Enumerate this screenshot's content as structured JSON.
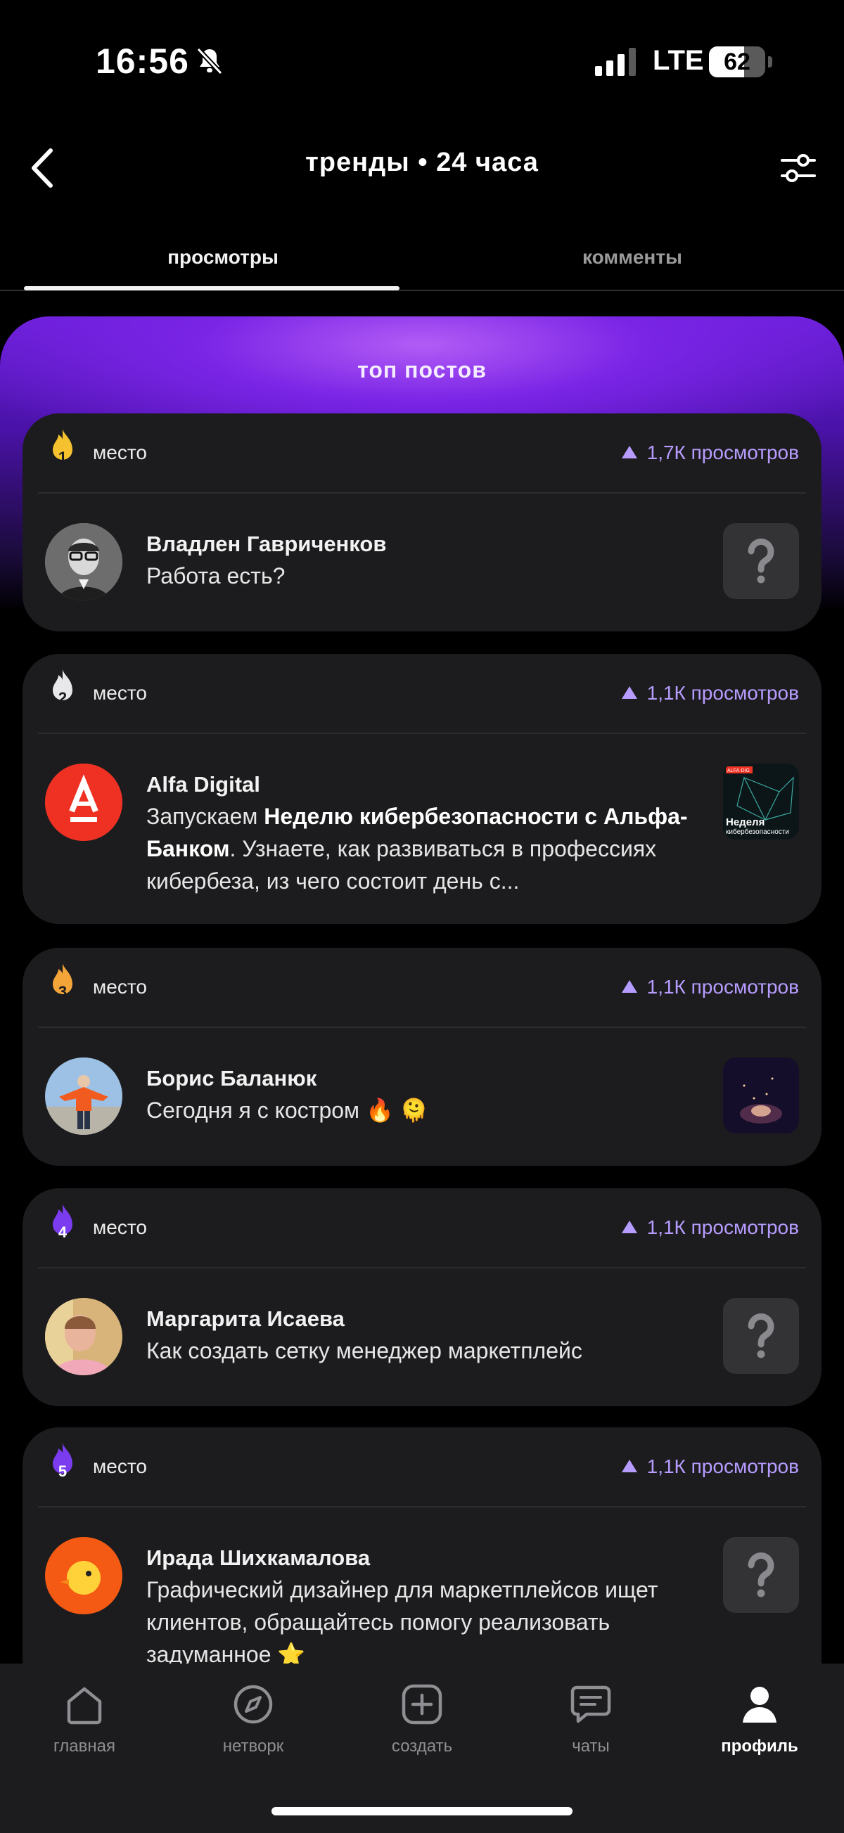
{
  "status_bar": {
    "time": "16:56",
    "network": "LTE",
    "battery": "62",
    "battery_level": 0.62
  },
  "header": {
    "title": "тренды • 24 часа"
  },
  "tabs": [
    {
      "label": "просмотры",
      "active": true
    },
    {
      "label": "комменты",
      "active": false
    }
  ],
  "section_title": "топ постов",
  "posts": [
    {
      "rank": "1",
      "rank_label": "место",
      "views": "1,7К просмотров",
      "author": "Владлен Гавриченков",
      "text": "Работа есть?",
      "thumb": "question"
    },
    {
      "rank": "2",
      "rank_label": "место",
      "views": "1,1К просмотров",
      "author": "Alfa Digital",
      "text_parts": [
        "Запускаем ",
        "Неделю кибербезопасности с Альфа-Банком",
        ". Узнаете, как развиваться в профессиях кибербеза, из чего состоит день с..."
      ],
      "thumb_title": "Неделя",
      "thumb_sub": "кибербезопасности",
      "thumb_badge": "ALFA·DIG"
    },
    {
      "rank": "3",
      "rank_label": "место",
      "views": "1,1К просмотров",
      "author": "Борис Баланюк",
      "text": "Сегодня я с костром 🔥 🫠",
      "thumb": "fire"
    },
    {
      "rank": "4",
      "rank_label": "место",
      "views": "1,1К просмотров",
      "author": "Маргарита Исаева",
      "text": "Как создать сетку менеджер маркетплейс",
      "thumb": "question"
    },
    {
      "rank": "5",
      "rank_label": "место",
      "views": "1,1К просмотров",
      "author": "Ирада Шихкамалова",
      "text": "Графический дизайнер для маркетплейсов ищет клиентов, обращайтесь помогу реализовать задуманное ⭐",
      "thumb": "question"
    }
  ],
  "rank_colors": {
    "1": "#f5c12e",
    "2": "#e8e8ea",
    "3": "#f3a53a",
    "4": "#7b3cf0",
    "5": "#7b3cf0"
  },
  "nav": [
    {
      "label": "главная",
      "icon": "home-icon"
    },
    {
      "label": "нетворк",
      "icon": "compass-icon"
    },
    {
      "label": "создать",
      "icon": "plus-square-icon"
    },
    {
      "label": "чаты",
      "icon": "chat-icon"
    },
    {
      "label": "профиль",
      "icon": "profile-icon",
      "active": true
    }
  ]
}
